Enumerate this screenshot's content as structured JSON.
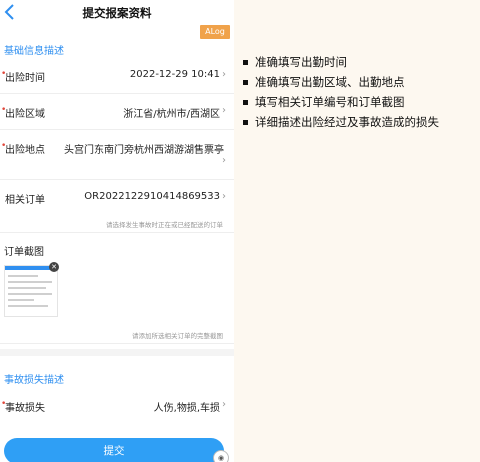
{
  "header": {
    "title": "提交报案资料"
  },
  "debug_badge": "ALog",
  "basic_section": {
    "title": "基础信息描述"
  },
  "fields": {
    "time": {
      "label": "出险时间",
      "value": "2022-12-29 10:41"
    },
    "area": {
      "label": "出险区域",
      "value": "浙江省/杭州市/西湖区"
    },
    "location": {
      "label": "出险地点",
      "value": "头宫门东南门旁杭州西湖游湖售票亭"
    },
    "order": {
      "label": "相关订单",
      "value": "OR2022122910414869533",
      "hint": "请选择发生事故时正在或已经配送的订单"
    },
    "screenshot": {
      "label": "订单截图",
      "hint": "请添加所选相关订单的完整截图"
    },
    "loss": {
      "label": "事故损失",
      "value": "人伤,物损,车损"
    }
  },
  "loss_section": {
    "title": "事故损失描述"
  },
  "submit_label": "提交",
  "notes": [
    "准确填写出勤时间",
    "准确填写出勤区域、出勤地点",
    "填写相关订单编号和订单截图",
    "详细描述出险经过及事故造成的损失"
  ]
}
